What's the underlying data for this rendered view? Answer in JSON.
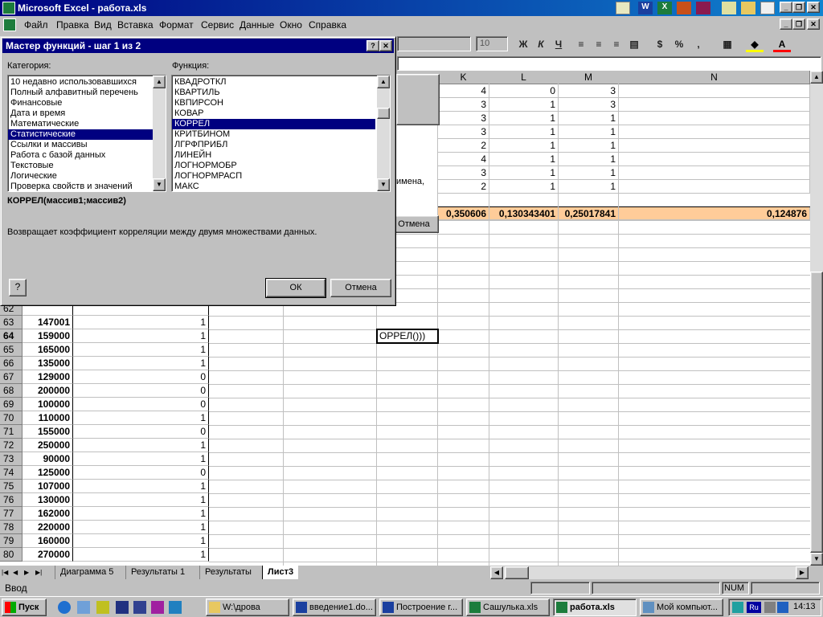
{
  "app": {
    "title": "Microsoft Excel - работа.xls",
    "menu": [
      "Файл",
      "Правка",
      "Вид",
      "Вставка",
      "Формат",
      "Сервис",
      "Данные",
      "Окно",
      "Справка"
    ],
    "font_size": "10"
  },
  "dialog": {
    "title": "Мастер функций - шаг 1 из 2",
    "category_label": "Категория:",
    "function_label": "Функция:",
    "categories": [
      "10 недавно использовавшихся",
      "Полный алфавитный перечень",
      "Финансовые",
      "Дата и время",
      "Математические",
      "Статистические",
      "Ссылки и массивы",
      "Работа с базой данных",
      "Текстовые",
      "Логические",
      "Проверка свойств и значений"
    ],
    "selected_category_index": 5,
    "functions": [
      "КВАДРОТКЛ",
      "КВАРТИЛЬ",
      "КВПИРСОН",
      "КОВАР",
      "КОРРЕЛ",
      "КРИТБИНОМ",
      "ЛГРФПРИБЛ",
      "ЛИНЕЙН",
      "ЛОГНОРМОБР",
      "ЛОГНОРМРАСП",
      "МАКС"
    ],
    "selected_function_index": 4,
    "syntax": "КОРРЕЛ(массив1;массив2)",
    "description": "Возвращает коэффициент корреляции между двумя множествами данных.",
    "ok_label": "ОК",
    "cancel_label": "Отмена"
  },
  "behind_dialog": {
    "partial_text": "имена,",
    "cancel_label": "Отмена"
  },
  "sheet": {
    "columns_visible": [
      "K",
      "L",
      "M",
      "N"
    ],
    "upper_rows": [
      {
        "K": "4",
        "L": "0",
        "M": "3"
      },
      {
        "K": "3",
        "L": "1",
        "M": "3"
      },
      {
        "K": "3",
        "L": "1",
        "M": "1"
      },
      {
        "K": "3",
        "L": "1",
        "M": "1"
      },
      {
        "K": "2",
        "L": "1",
        "M": "1"
      },
      {
        "K": "4",
        "L": "1",
        "M": "1"
      },
      {
        "K": "3",
        "L": "1",
        "M": "1"
      },
      {
        "K": "2",
        "L": "1",
        "M": "1"
      }
    ],
    "result_row": {
      "J": "0,350606",
      "K": "0,130343401",
      "L": "0,25017841",
      "N": "0,124876"
    },
    "lower_rows": [
      {
        "n": "62",
        "b": "",
        "c": ""
      },
      {
        "n": "63",
        "b": "147001",
        "c": "1"
      },
      {
        "n": "64",
        "b": "159000",
        "c": "1"
      },
      {
        "n": "65",
        "b": "165000",
        "c": "1"
      },
      {
        "n": "66",
        "b": "135000",
        "c": "1"
      },
      {
        "n": "67",
        "b": "129000",
        "c": "0"
      },
      {
        "n": "68",
        "b": "200000",
        "c": "0"
      },
      {
        "n": "69",
        "b": "100000",
        "c": "0"
      },
      {
        "n": "70",
        "b": "110000",
        "c": "1"
      },
      {
        "n": "71",
        "b": "155000",
        "c": "0"
      },
      {
        "n": "72",
        "b": "250000",
        "c": "1"
      },
      {
        "n": "73",
        "b": "90000",
        "c": "1"
      },
      {
        "n": "74",
        "b": "125000",
        "c": "0"
      },
      {
        "n": "75",
        "b": "107000",
        "c": "1"
      },
      {
        "n": "76",
        "b": "130000",
        "c": "1"
      },
      {
        "n": "77",
        "b": "162000",
        "c": "1"
      },
      {
        "n": "78",
        "b": "220000",
        "c": "1"
      },
      {
        "n": "79",
        "b": "160000",
        "c": "1"
      },
      {
        "n": "80",
        "b": "270000",
        "c": "1"
      }
    ],
    "active_cell_text": "ОРРЕЛ()))"
  },
  "tabs": [
    "Диаграмма 5",
    "Результаты 1",
    "Результаты",
    "Лист3"
  ],
  "active_tab": "Лист3",
  "status": {
    "mode": "Ввод",
    "num": "NUM"
  },
  "taskbar": {
    "start": "Пуск",
    "tasks": [
      "W:\\дрова",
      "введение1.do...",
      "Построение г...",
      "Сашулька.xls",
      "работа.xls",
      "Мой компьют..."
    ],
    "lang": "Ru",
    "clock": "14:13"
  },
  "colors": {
    "selection": "#000080",
    "result_row": "#ffcc99",
    "titlebar": "#000080"
  }
}
